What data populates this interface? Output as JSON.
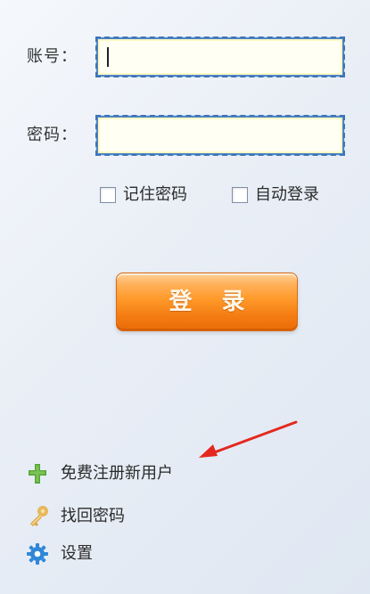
{
  "login": {
    "account_label": "账号：",
    "account_value": "",
    "password_label": "密码：",
    "password_value": "",
    "remember_password_label": "记住密码",
    "auto_login_label": "自动登录",
    "submit_label": "登 录"
  },
  "links": {
    "register": "免费注册新用户",
    "recover_password": "找回密码",
    "settings": "设置"
  },
  "colors": {
    "accent_orange": "#f48a1b",
    "input_border": "#4f87c7",
    "arrow_red": "#e5281f",
    "register_icon": "#57a637",
    "key_icon": "#e0b24b",
    "settings_icon": "#2f87d8"
  },
  "icons": {
    "register": "plus-cross-icon",
    "recover_password": "key-icon",
    "settings": "gear-icon"
  },
  "states": {
    "remember_password_checked": false,
    "auto_login_checked": false
  }
}
